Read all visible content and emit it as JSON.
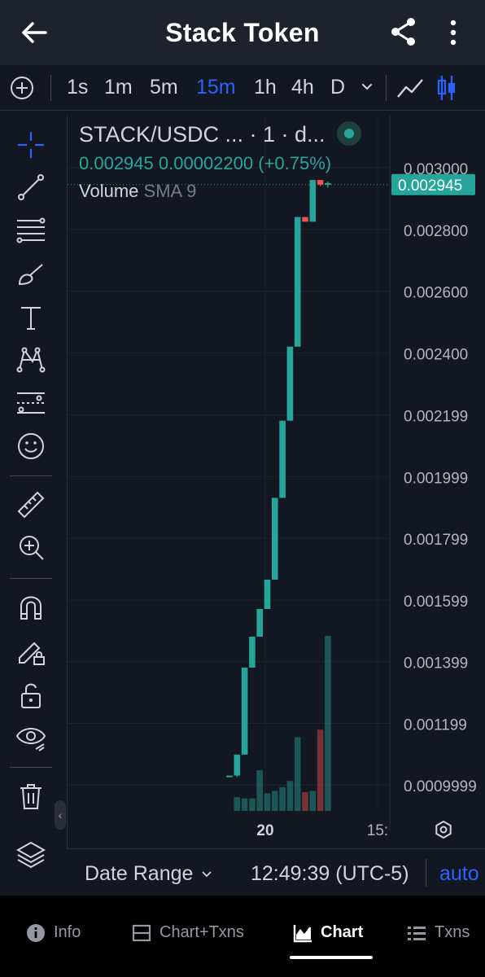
{
  "appbar": {
    "title": "Stack Token"
  },
  "toolbar": {
    "timeframes": [
      "1s",
      "1m",
      "5m",
      "15m",
      "1h",
      "4h",
      "D"
    ],
    "active_timeframe": "15m"
  },
  "legend": {
    "symbol": "STACK/USDC ... · 1 · d...",
    "price": "0.002945",
    "change": "0.00002200",
    "change_pct": "(+0.75%)",
    "volume_label": "Volume",
    "sma_label": "SMA 9"
  },
  "price_axis": {
    "ticks": [
      "0.003000",
      "0.002800",
      "0.002600",
      "0.002400",
      "0.002199",
      "0.001999",
      "0.001799",
      "0.001599",
      "0.001399",
      "0.001199",
      "0.0009999"
    ],
    "current_price": "0.002945"
  },
  "time_axis": {
    "labels": [
      "20",
      "15:"
    ]
  },
  "range_bar": {
    "date_range": "Date Range",
    "time": "12:49:39 (UTC-5)",
    "auto": "auto"
  },
  "nav": {
    "info": "Info",
    "chart_txns": "Chart+Txns",
    "chart": "Chart",
    "txns": "Txns"
  },
  "colors": {
    "up": "#26a69a",
    "down": "#ef5350",
    "accent": "#2962ff",
    "background": "#131722"
  },
  "chart_data": {
    "type": "candlestick",
    "y_axis_range": [
      0.00094,
      0.00303
    ],
    "current_price": 0.002945,
    "candles": [
      {
        "o": 0.001025,
        "c": 0.00103,
        "h": 0.00103,
        "l": 0.001025,
        "v": 0
      },
      {
        "o": 0.00103,
        "c": 0.001098,
        "h": 0.001098,
        "l": 0.001025,
        "v": 0.22
      },
      {
        "o": 0.001098,
        "c": 0.00138,
        "h": 0.00138,
        "l": 0.001098,
        "v": 0.2
      },
      {
        "o": 0.00138,
        "c": 0.00148,
        "h": 0.00148,
        "l": 0.00138,
        "v": 0.2
      },
      {
        "o": 0.00148,
        "c": 0.00157,
        "h": 0.00157,
        "l": 0.00148,
        "v": 0.65
      },
      {
        "o": 0.00157,
        "c": 0.001665,
        "h": 0.001665,
        "l": 0.00157,
        "v": 0.28
      },
      {
        "o": 0.001665,
        "c": 0.00193,
        "h": 0.00193,
        "l": 0.001665,
        "v": 0.32
      },
      {
        "o": 0.00193,
        "c": 0.00218,
        "h": 0.00218,
        "l": 0.00193,
        "v": 0.38
      },
      {
        "o": 0.00218,
        "c": 0.00242,
        "h": 0.00242,
        "l": 0.00218,
        "v": 0.48
      },
      {
        "o": 0.00242,
        "c": 0.00284,
        "h": 0.00284,
        "l": 0.00242,
        "v": 1.18
      },
      {
        "o": 0.00284,
        "c": 0.002825,
        "h": 0.00284,
        "l": 0.002825,
        "v": 0.3
      },
      {
        "o": 0.002825,
        "c": 0.00296,
        "h": 0.00296,
        "l": 0.002825,
        "v": 0.32
      },
      {
        "o": 0.00296,
        "c": 0.002945,
        "h": 0.00296,
        "l": 0.00294,
        "v": 1.3
      },
      {
        "o": 0.002945,
        "c": 0.00295,
        "h": 0.002955,
        "l": 0.002935,
        "v": 2.8
      }
    ]
  }
}
